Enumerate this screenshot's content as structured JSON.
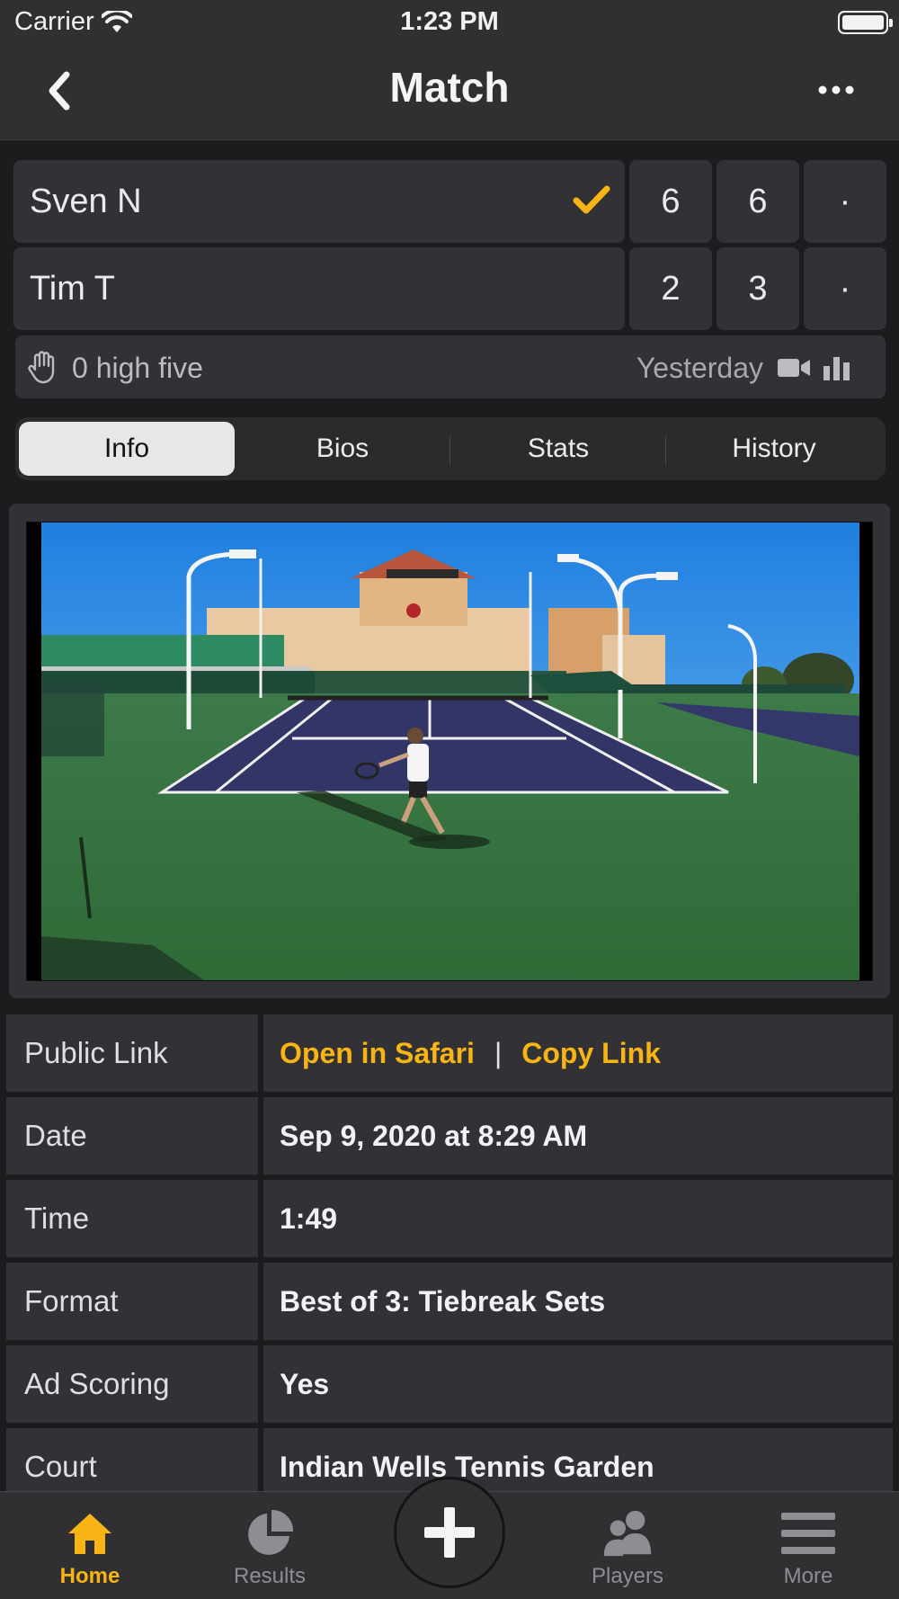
{
  "status_bar": {
    "carrier": "Carrier",
    "time": "1:23 PM"
  },
  "nav": {
    "title": "Match"
  },
  "scoreboard": {
    "players": [
      {
        "name": "Sven N",
        "sets": [
          "6",
          "6",
          "·"
        ],
        "winner": true
      },
      {
        "name": "Tim T",
        "sets": [
          "2",
          "3",
          "·"
        ],
        "winner": false
      }
    ]
  },
  "meta": {
    "high_five": "0 high five",
    "date": "Yesterday"
  },
  "tabs": {
    "items": [
      {
        "label": "Info",
        "active": true
      },
      {
        "label": "Bios",
        "active": false
      },
      {
        "label": "Stats",
        "active": false
      },
      {
        "label": "History",
        "active": false
      }
    ]
  },
  "info": {
    "public_link_label": "Public Link",
    "open_in_safari": "Open in Safari",
    "separator": "|",
    "copy_link": "Copy Link",
    "rows": [
      {
        "label": "Date",
        "value": "Sep 9, 2020 at 8:29 AM"
      },
      {
        "label": "Time",
        "value": "1:49"
      },
      {
        "label": "Format",
        "value": "Best of 3: Tiebreak Sets"
      },
      {
        "label": "Ad Scoring",
        "value": "Yes"
      },
      {
        "label": "Court",
        "value": "Indian Wells Tennis Garden"
      }
    ]
  },
  "tab_bar": {
    "items": [
      {
        "label": "Home",
        "icon": "home-icon",
        "active": true
      },
      {
        "label": "Results",
        "icon": "pie-chart-icon",
        "active": false
      },
      {
        "label": "Players",
        "icon": "players-icon",
        "active": false
      },
      {
        "label": "More",
        "icon": "menu-icon",
        "active": false
      }
    ]
  },
  "colors": {
    "accent": "#f7b414",
    "background": "#1c1c1e",
    "cell": "#323236"
  }
}
